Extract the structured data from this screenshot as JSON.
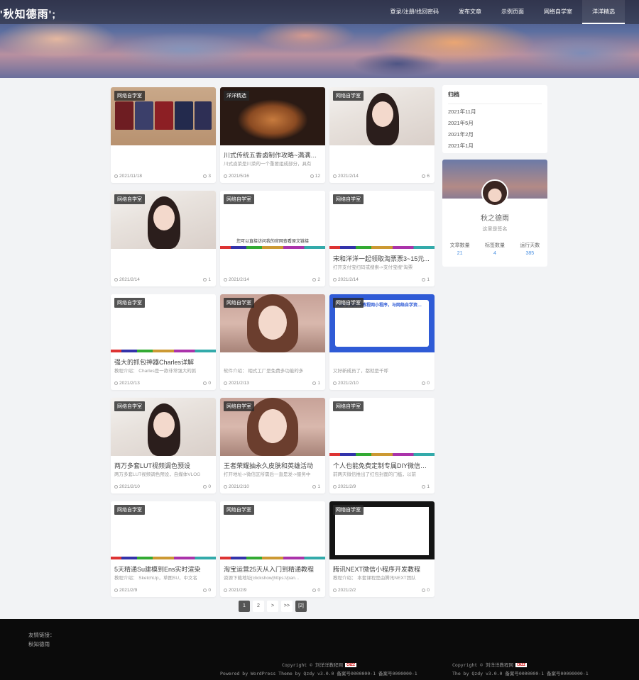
{
  "site": {
    "logo": "'秋知德雨';"
  },
  "nav": {
    "items": [
      "登录/注册/找回密码",
      "发布文章",
      "示例页面",
      "网络自学室",
      "洋洋精选"
    ],
    "active": 4
  },
  "posts": [
    {
      "category": "网络自学室",
      "title": "",
      "excerpt": "",
      "date": "2021/11/18",
      "likes": "3",
      "thumb": "passports"
    },
    {
      "category": "洋洋精选",
      "title": "川式传统五香卤制作攻略~满满干货~",
      "excerpt": "川式卤菜是川菜的一个重要组成部分，具有",
      "date": "2021/5/16",
      "likes": "12",
      "thumb": "food"
    },
    {
      "category": "网络自学室",
      "title": "",
      "excerpt": "",
      "date": "2021/2/14",
      "likes": "6",
      "thumb": "girl"
    },
    {
      "category": "网络自学室",
      "title": "",
      "excerpt": "",
      "date": "2021/2/14",
      "likes": "1",
      "thumb": "girl"
    },
    {
      "category": "网络自学室",
      "title": "",
      "excerpt": "",
      "date": "2021/2/14",
      "likes": "2",
      "thumb": "blank-text",
      "thumb_text": "您可以直接访问我的官网查看原文链接"
    },
    {
      "category": "网络自学室",
      "title": "宋和洋洋一起领取淘票票3~15元...",
      "excerpt": "打开支付宝扫码或搜索->支付宝搜\"淘票",
      "date": "2021/2/14",
      "likes": "1",
      "thumb": "blank"
    },
    {
      "category": "网络自学室",
      "title": "强大的抓包神器Charles详解",
      "excerpt": "教程介绍： Charles是一款非常强大的抓",
      "date": "2021/2/13",
      "likes": "0",
      "thumb": "blank"
    },
    {
      "category": "网络自学室",
      "title": "",
      "excerpt": "软件介绍： 相式工厂是免费多功能的多",
      "date": "2021/2/13",
      "likes": "1",
      "thumb": "warm"
    },
    {
      "category": "网络自学室",
      "title": "",
      "excerpt": "又好新成员了，都就是千呼",
      "date": "2021/2/10",
      "likes": "0",
      "thumb": "blue",
      "thumb_text": "同步于刘洋洋教程网小程序，与网络自学资源免费分享"
    },
    {
      "category": "网络自学室",
      "title": "两万多套LUT视频调色预设",
      "excerpt": "两万多套LUT视频调色预设，自媒体VLOG",
      "date": "2021/2/10",
      "likes": "0",
      "thumb": "girl"
    },
    {
      "category": "网络自学室",
      "title": "王者荣耀抽永久皮肤和英雄活动",
      "excerpt": "打开地址->微信区所需后一直是发->服务中",
      "date": "2021/2/10",
      "likes": "1",
      "thumb": "warm"
    },
    {
      "category": "网络自学室",
      "title": "个人也能免费定制专属DIY微信红...",
      "excerpt": "前两天微信推出了红包封面的门槛，以前",
      "date": "2021/2/9",
      "likes": "1",
      "thumb": "blank"
    },
    {
      "category": "网络自学室",
      "title": "5天精通Su建模到Ens实时渲染",
      "excerpt": "教程介绍： SketchUp，草图SU，中文名",
      "date": "2021/2/9",
      "likes": "0",
      "thumb": "blank"
    },
    {
      "category": "网络自学室",
      "title": "淘宝运营25天从入门到精通教程",
      "excerpt": "资源下载地址[clickshow]https://pan...",
      "date": "2021/2/9",
      "likes": "0",
      "thumb": "blank"
    },
    {
      "category": "网络自学室",
      "title": "腾讯NEXT微信小程序开发教程",
      "excerpt": "教程介绍： 本套课程是由腾讯NEXT团队",
      "date": "2021/2/2",
      "likes": "0",
      "thumb": "dark"
    }
  ],
  "archive": {
    "title": "归档",
    "months": [
      "2021年11月",
      "2021年5月",
      "2021年2月",
      "2021年1月"
    ]
  },
  "profile": {
    "name": "秋之德雨",
    "signature": "这里是签名",
    "stats": [
      {
        "label": "文章数量",
        "value": "21"
      },
      {
        "label": "标签数量",
        "value": "4"
      },
      {
        "label": "运行天数",
        "value": "385"
      }
    ]
  },
  "pagination": {
    "pages": [
      "1",
      "2",
      ">",
      ">>"
    ],
    "current": "1",
    "total": "[2]"
  },
  "footer": {
    "links_label": "友情链接：",
    "link": "秋知德雨",
    "copyright_left": "Copyright © 刘洋洋教程网",
    "theme_left": "Powered by WordPress Theme by Qzdy v3.0.0 备案号0000000-1 备案号0000000-1",
    "copyright_right": "Copyright © 刘洋洋教程网",
    "theme_right": "The by Qzdy v3.0.0 备案号0000000-1 备案号00000000-1",
    "cnzz": "CNZZ"
  },
  "colors": {
    "accent": "#4a90e2",
    "footer_bg": "#0b0b0b",
    "page_bg": "#f2f3f5"
  }
}
